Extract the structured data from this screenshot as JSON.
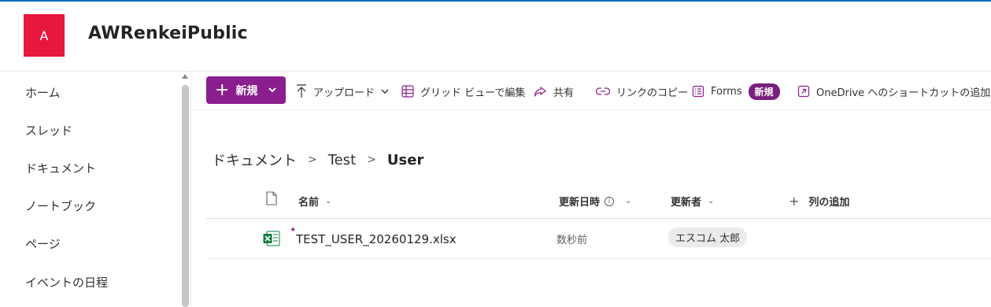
{
  "site": {
    "logo_letter": "A",
    "title": "AWRenkeiPublic",
    "logo_color": "#e8173f"
  },
  "sidebar": {
    "items": [
      {
        "label": "ホーム"
      },
      {
        "label": "スレッド"
      },
      {
        "label": "ドキュメント"
      },
      {
        "label": "ノートブック"
      },
      {
        "label": "ページ"
      },
      {
        "label": "イベントの日程"
      }
    ]
  },
  "toolbar": {
    "new_label": "新規",
    "upload_label": "アップロード",
    "grid_edit_label": "グリッド ビューで編集",
    "share_label": "共有",
    "copy_link_label": "リンクのコピー",
    "forms_label": "Forms",
    "forms_badge": "新規",
    "onedrive_label": "OneDrive へのショートカットの追加",
    "accent_color": "#8b1e8e"
  },
  "breadcrumb": {
    "items": [
      "ドキュメント",
      "Test",
      "User"
    ],
    "separator": ">"
  },
  "list": {
    "columns": {
      "name": "名前",
      "modified": "更新日時",
      "modified_by": "更新者",
      "add_column": "列の追加"
    },
    "rows": [
      {
        "name": "TEST_USER_20260129.xlsx",
        "modified": "数秒前",
        "modified_by": "エスコム 太郎",
        "file_icon": "excel-icon"
      }
    ]
  }
}
